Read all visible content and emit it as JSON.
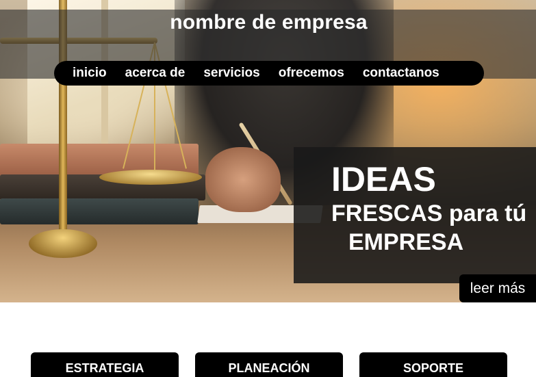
{
  "header": {
    "company_name": "nombre de empresa"
  },
  "nav": {
    "items": [
      {
        "label": "inicio"
      },
      {
        "label": "acerca de"
      },
      {
        "label": "servicios"
      },
      {
        "label": "ofrecemos"
      },
      {
        "label": "contactanos"
      }
    ]
  },
  "hero": {
    "line1": "IDEAS",
    "line2": "FRESCAS para tú",
    "line3": "EMPRESA",
    "cta_label": "leer más"
  },
  "cards": [
    {
      "label": "ESTRATEGIA"
    },
    {
      "label": "PLANEACIÓN"
    },
    {
      "label": "SOPORTE"
    }
  ]
}
